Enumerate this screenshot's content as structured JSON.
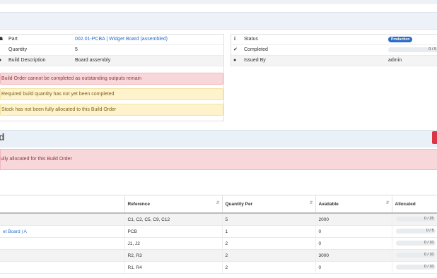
{
  "colors": {
    "accent": "#2a6dc8",
    "danger": "#dc3545",
    "warning_bg": "#fff3cd",
    "danger_bg": "#f8d7da"
  },
  "details_left": [
    {
      "icon": "sitemap-icon",
      "label": "Part",
      "value": "002.01-PCBA | Widget Board (assembled)",
      "link": true
    },
    {
      "icon": "",
      "label": "Quantity",
      "value": "5",
      "link": false
    },
    {
      "icon": "info-circle-icon",
      "label": "Build Description",
      "value": "Board assembly",
      "link": false
    }
  ],
  "details_right": {
    "status_label": "Status",
    "status_badge": "Production",
    "completed_label": "Completed",
    "completed_value": "0 / 5",
    "issued_label": "Issued By",
    "issued_value": "admin"
  },
  "alerts": [
    {
      "type": "red",
      "text": "Build Order cannot be completed as outstanding outputs remain"
    },
    {
      "type": "yel",
      "text": "Required build quantity has not yet been completed"
    },
    {
      "type": "yel",
      "text": "Stock has not been fully allocated to this Build Order"
    }
  ],
  "section": {
    "title": "d",
    "alert": "ully allocated for this Build Order"
  },
  "table": {
    "headers": [
      "",
      "Reference",
      "Quantity Per",
      "Available",
      "Allocated"
    ],
    "rows": [
      {
        "part": "",
        "reference": "C1, C2, C5, C9, C12",
        "qty": "5",
        "available": "2000",
        "allocated": "0 / 25"
      },
      {
        "part": "et Board | A",
        "reference": "PCB",
        "qty": "1",
        "available": "0",
        "allocated": "0 / 5"
      },
      {
        "part": "",
        "reference": "J1, J2",
        "qty": "2",
        "available": "0",
        "allocated": "0 / 10"
      },
      {
        "part": "",
        "reference": "R2, R3",
        "qty": "2",
        "available": "3000",
        "allocated": "0 / 10"
      },
      {
        "part": "",
        "reference": "R1, R4",
        "qty": "2",
        "available": "0",
        "allocated": "0 / 10"
      }
    ]
  }
}
